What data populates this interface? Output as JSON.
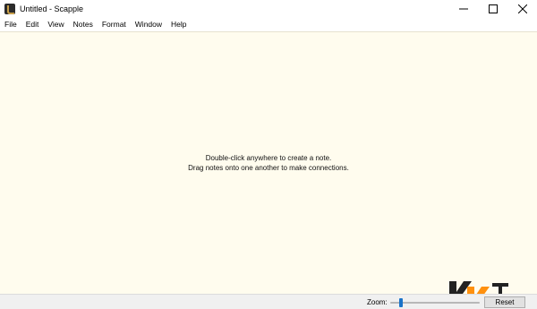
{
  "window": {
    "title": "Untitled - Scapple",
    "icon": "scapple-app-icon"
  },
  "menubar": {
    "items": [
      "File",
      "Edit",
      "View",
      "Notes",
      "Format",
      "Window",
      "Help"
    ]
  },
  "canvas": {
    "background_color": "#fffcee",
    "hint_line1": "Double-click anywhere to create a note.",
    "hint_line2": "Drag notes onto one another to make connections."
  },
  "statusbar": {
    "zoom_label": "Zoom:",
    "zoom_level": 0.1,
    "reset_label": "Reset"
  },
  "colors": {
    "slider_thumb": "#1a73c8",
    "watermark_dark": "#222222",
    "watermark_orange": "#ff8a00"
  }
}
